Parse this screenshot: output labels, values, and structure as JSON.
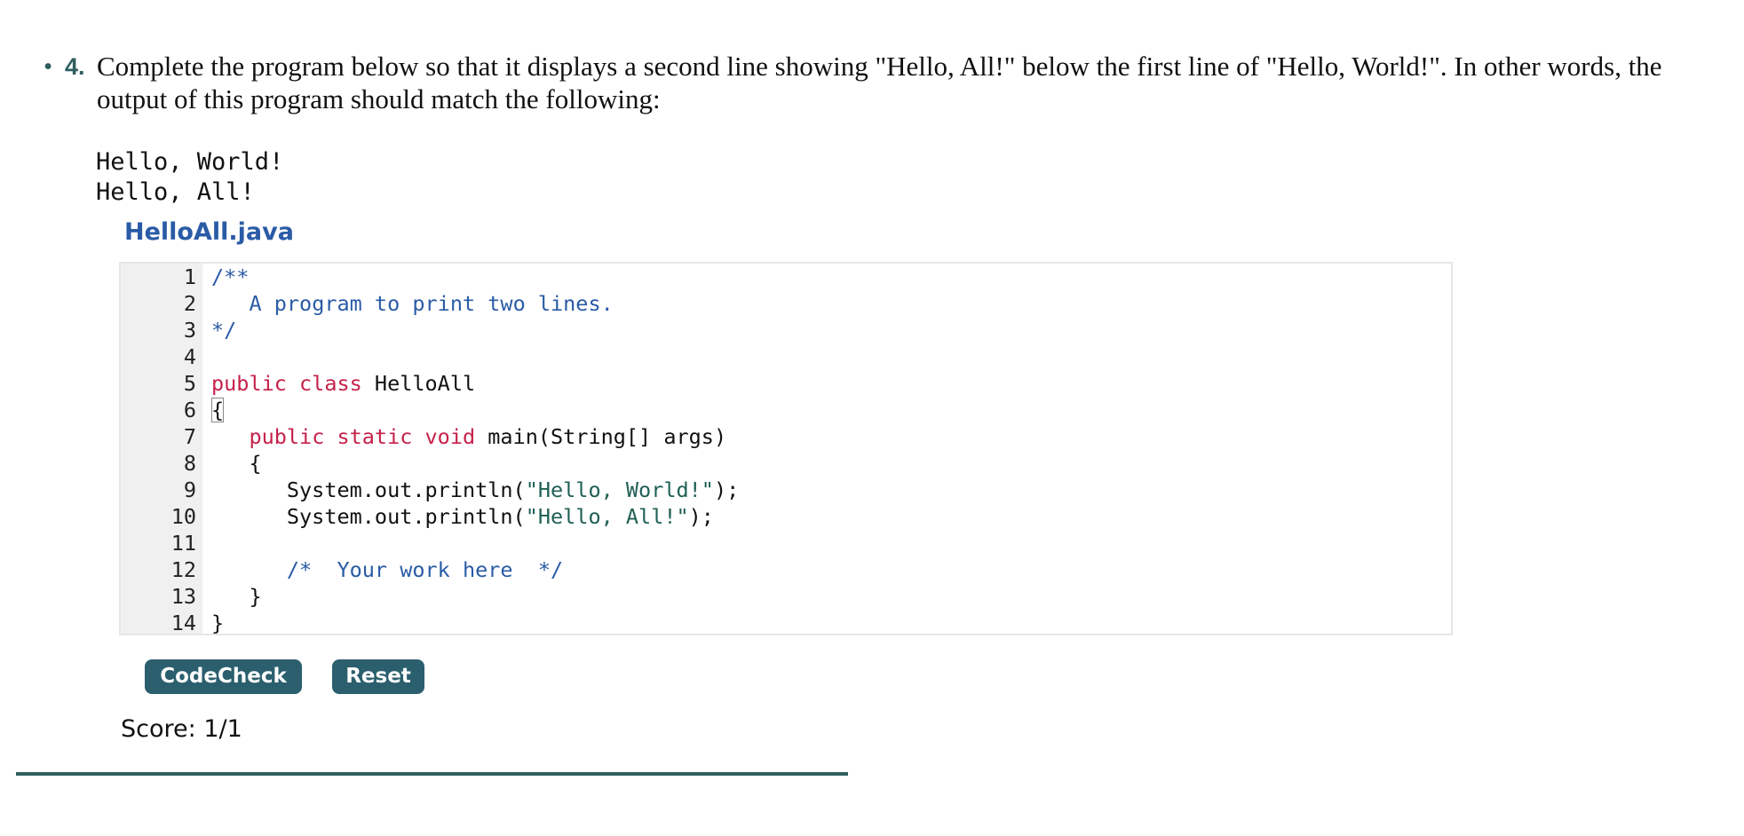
{
  "question": {
    "bullet": "•",
    "number": "4.",
    "text": "Complete the program below so that it displays a second line showing \"Hello, All!\" below the first line of \"Hello, World!\". In other words, the output of this program should match the following:"
  },
  "expected_output": [
    "Hello, World!",
    "Hello, All!"
  ],
  "editor": {
    "filename": "HelloAll.java",
    "lines": [
      {
        "num": "1",
        "indent": "",
        "parts": [
          {
            "t": "/**",
            "c": "cm"
          }
        ]
      },
      {
        "num": "2",
        "indent": "   ",
        "parts": [
          {
            "t": "A program to print two lines.",
            "c": "cm"
          }
        ]
      },
      {
        "num": "3",
        "indent": "",
        "parts": [
          {
            "t": "*/",
            "c": "cm"
          }
        ]
      },
      {
        "num": "4",
        "indent": "",
        "parts": []
      },
      {
        "num": "5",
        "indent": "",
        "parts": [
          {
            "t": "public class",
            "c": "kw"
          },
          {
            "t": " HelloAll",
            "c": ""
          }
        ]
      },
      {
        "num": "6",
        "indent": "",
        "parts": [
          {
            "t": "{",
            "c": "brace"
          }
        ]
      },
      {
        "num": "7",
        "indent": "   ",
        "parts": [
          {
            "t": "public static void",
            "c": "kw"
          },
          {
            "t": " main(String[] args)",
            "c": ""
          }
        ]
      },
      {
        "num": "8",
        "indent": "   ",
        "parts": [
          {
            "t": "{",
            "c": ""
          }
        ]
      },
      {
        "num": "9",
        "indent": "      ",
        "parts": [
          {
            "t": "System.out.println(",
            "c": ""
          },
          {
            "t": "\"Hello, World!\"",
            "c": "str"
          },
          {
            "t": ");",
            "c": ""
          }
        ]
      },
      {
        "num": "10",
        "indent": "      ",
        "parts": [
          {
            "t": "System.out.println(",
            "c": ""
          },
          {
            "t": "\"Hello, All!\"",
            "c": "str"
          },
          {
            "t": ");",
            "c": ""
          }
        ]
      },
      {
        "num": "11",
        "indent": "",
        "parts": []
      },
      {
        "num": "12",
        "indent": "      ",
        "parts": [
          {
            "t": "/*  Your work here  */",
            "c": "cm"
          }
        ]
      },
      {
        "num": "13",
        "indent": "   ",
        "parts": [
          {
            "t": "}",
            "c": ""
          }
        ]
      },
      {
        "num": "14",
        "indent": "",
        "parts": [
          {
            "t": "}",
            "c": ""
          }
        ]
      }
    ]
  },
  "buttons": {
    "codecheck": "CodeCheck",
    "reset": "Reset"
  },
  "score": {
    "label": "Score:",
    "value": "1/1"
  },
  "colors": {
    "accent": "#2b5f6e",
    "filename": "#2a5ba6",
    "keyword": "#c6214a",
    "comment": "#2a5ba6",
    "string": "#1f5f55",
    "gutter": "#f0f0f0"
  }
}
